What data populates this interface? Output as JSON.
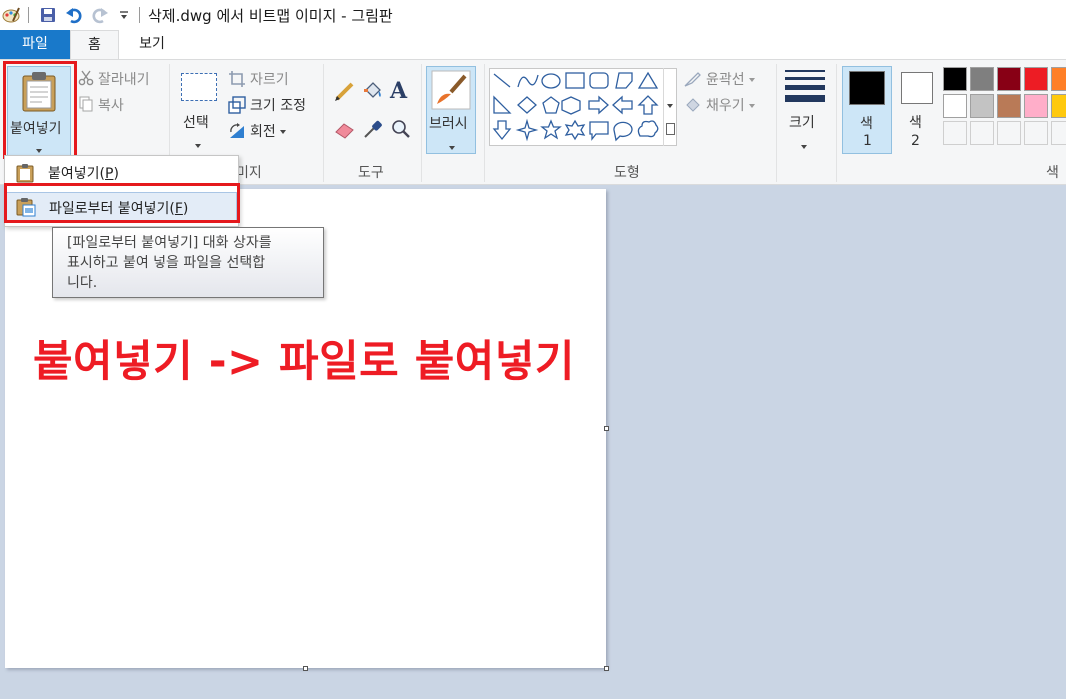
{
  "title_bar": {
    "title": "삭제.dwg 에서 비트맵 이미지 - 그림판",
    "quick_access": [
      "save-icon",
      "undo-icon",
      "redo-icon",
      "customize-dropdown-icon"
    ]
  },
  "tabs": [
    {
      "label": "파일",
      "active": false
    },
    {
      "label": "홈",
      "active": true
    },
    {
      "label": "보기",
      "active": false
    }
  ],
  "ribbon": {
    "clipboard": {
      "paste_label": "붙여넣기",
      "cut_label": "잘라내기",
      "copy_label": "복사"
    },
    "image": {
      "select_label": "선택",
      "crop_label": "자르기",
      "resize_label": "크기 조정",
      "rotate_label": "회전",
      "group_label_partial": "미지"
    },
    "tools": {
      "group_label": "도구",
      "icons": [
        "pencil-icon",
        "fill-bucket-icon",
        "text-icon",
        "eraser-icon",
        "color-picker-icon",
        "magnifier-icon"
      ]
    },
    "brush_label": "브러시",
    "shapes": {
      "outline_label": "윤곽선",
      "fill_label": "채우기",
      "group_label": "도형"
    },
    "size_label": "크기",
    "colors": {
      "color1_label": "색\n1",
      "color1_line1": "색",
      "color1_line2": "1",
      "color2_line1": "색",
      "color2_line2": "2",
      "color1": "#000000",
      "color2": "#ffffff",
      "group_label_partial": "색",
      "palette_row1": [
        "#000000",
        "#7f7f7f",
        "#880015",
        "#ed1c24",
        "#ff7f27"
      ],
      "palette_row2": [
        "#ffffff",
        "#c3c3c3",
        "#b97a57",
        "#ffaec9",
        "#ffc90e"
      ],
      "palette_row3": [
        "",
        "",
        "",
        "",
        ""
      ]
    }
  },
  "paste_menu": {
    "items": [
      {
        "label": "붙여넣기(P)",
        "text": "붙여넣기",
        "key": "P"
      },
      {
        "label": "파일로부터 붙여넣기(F)",
        "text": "파일로부터 붙여넣기",
        "key": "F"
      }
    ]
  },
  "tooltip": {
    "lines": [
      "[파일로부터 붙여넣기] 대화 상자를",
      "표시하고 붙여 넣을 파일을 선택합",
      "니다."
    ]
  },
  "canvas": {
    "annotation": "붙여넣기 -> 파일로 붙여넣기"
  },
  "accent_colors": {
    "file_tab": "#1979ca",
    "highlight_box": "#e5191d",
    "annotation_text": "#ee1c24",
    "selected_button": "#cde6f7"
  }
}
